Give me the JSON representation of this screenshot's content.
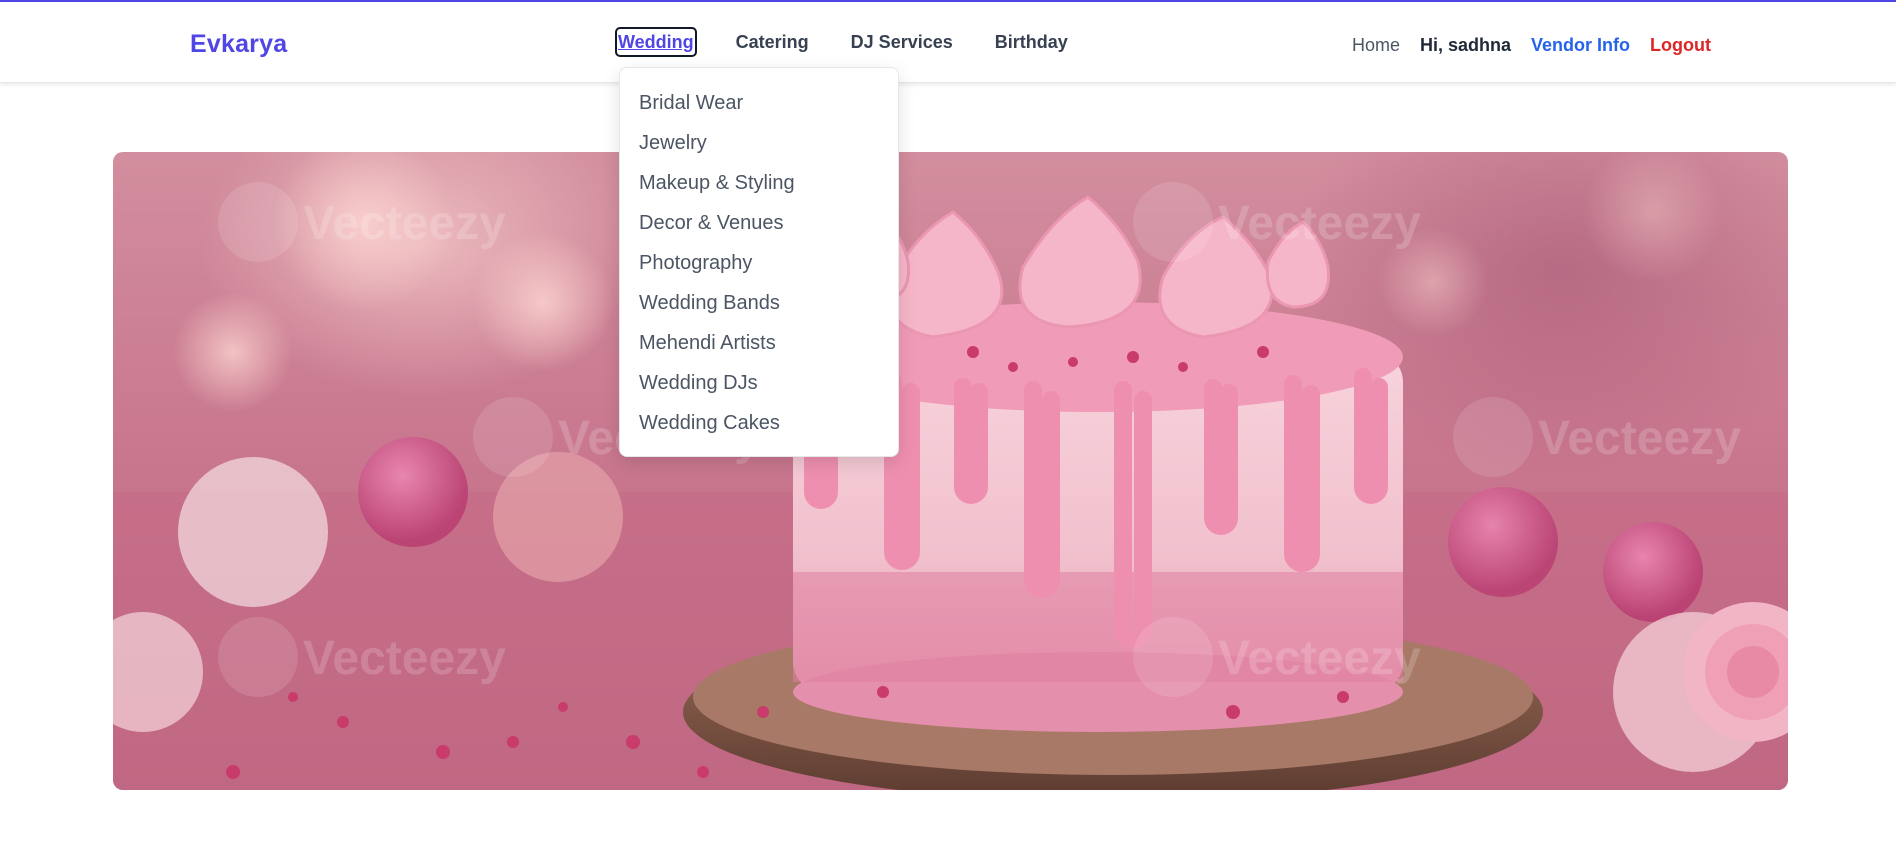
{
  "brand": {
    "name": "Evkarya"
  },
  "nav": {
    "main": [
      {
        "label": "Wedding",
        "active": true
      },
      {
        "label": "Catering"
      },
      {
        "label": "DJ Services"
      },
      {
        "label": "Birthday"
      }
    ],
    "home": "Home",
    "greeting": "Hi, sadhna",
    "vendor_info": "Vendor Info",
    "logout": "Logout"
  },
  "dropdown": {
    "items": [
      "Bridal Wear",
      "Jewelry",
      "Makeup & Styling",
      "Decor & Venues",
      "Photography",
      "Wedding Bands",
      "Mehendi Artists",
      "Wedding DJs",
      "Wedding Cakes"
    ]
  },
  "hero": {
    "watermark": "Vecteezy"
  },
  "colors": {
    "accent": "#4f46e5",
    "vendor_link": "#2563eb",
    "logout": "#dc2626"
  }
}
